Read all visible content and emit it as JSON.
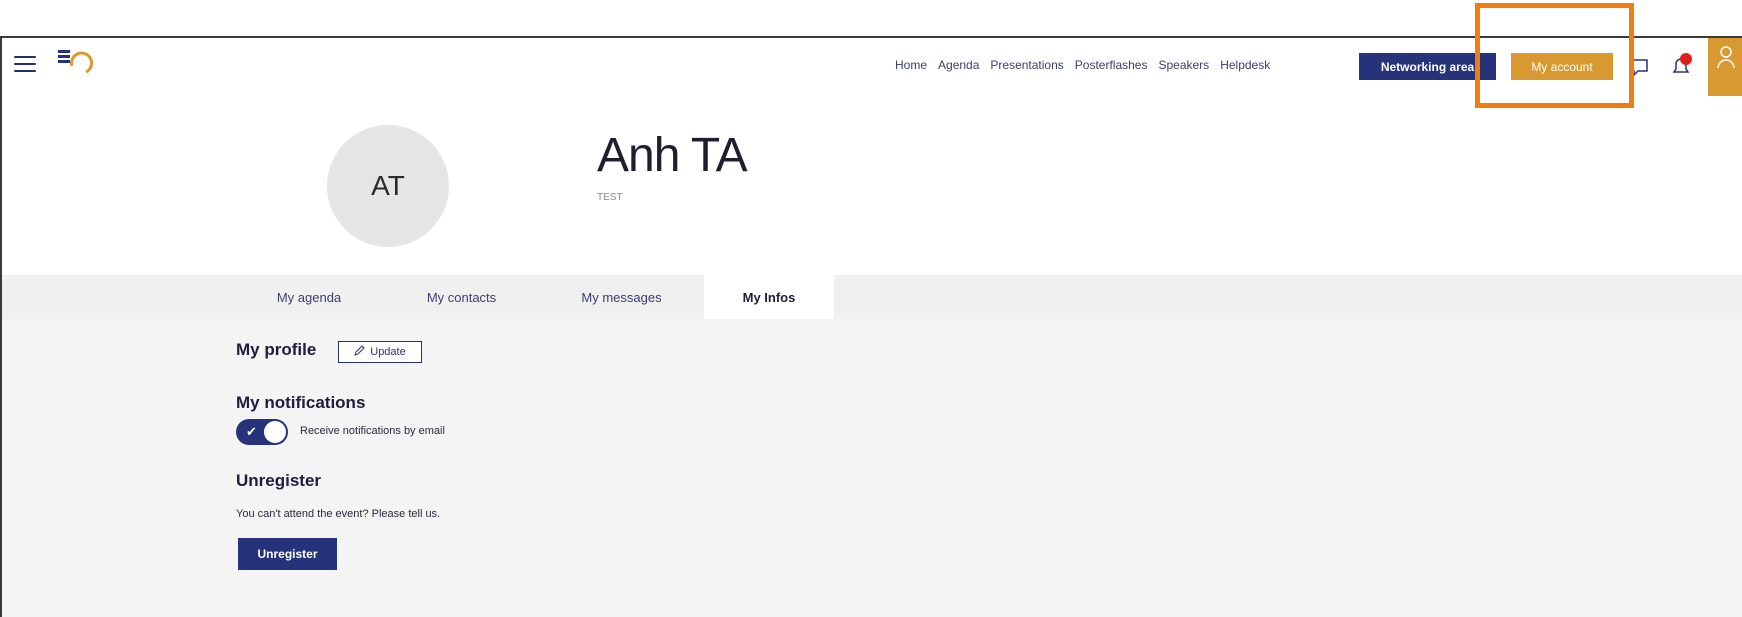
{
  "nav": {
    "links": [
      "Home",
      "Agenda",
      "Presentations",
      "Posterflashes",
      "Speakers",
      "Helpdesk"
    ],
    "networking_label": "Networking area",
    "account_label": "My account",
    "icons": [
      "hamburger-menu-icon",
      "logo",
      "chat-icon",
      "bell-icon",
      "user-icon"
    ],
    "notification_badge_color": "#e0201a"
  },
  "profile": {
    "initials": "AT",
    "name": "Anh TA",
    "subtitle": "TEST"
  },
  "tabs": [
    {
      "label": "My agenda"
    },
    {
      "label": "My contacts"
    },
    {
      "label": "My messages"
    },
    {
      "label": "My Infos",
      "active": true
    }
  ],
  "sections": {
    "profile_title": "My profile",
    "update_label": "Update",
    "notifications_title": "My notifications",
    "notifications_toggle_label": "Receive notifications by email",
    "notifications_enabled": true,
    "unregister_title": "Unregister",
    "unregister_text": "You can't attend the event? Please tell us.",
    "unregister_button": "Unregister"
  },
  "colors": {
    "primary": "#26327a",
    "accent": "#d89a30",
    "highlight": "#f07d10",
    "content_bg": "#f4f4f4"
  }
}
